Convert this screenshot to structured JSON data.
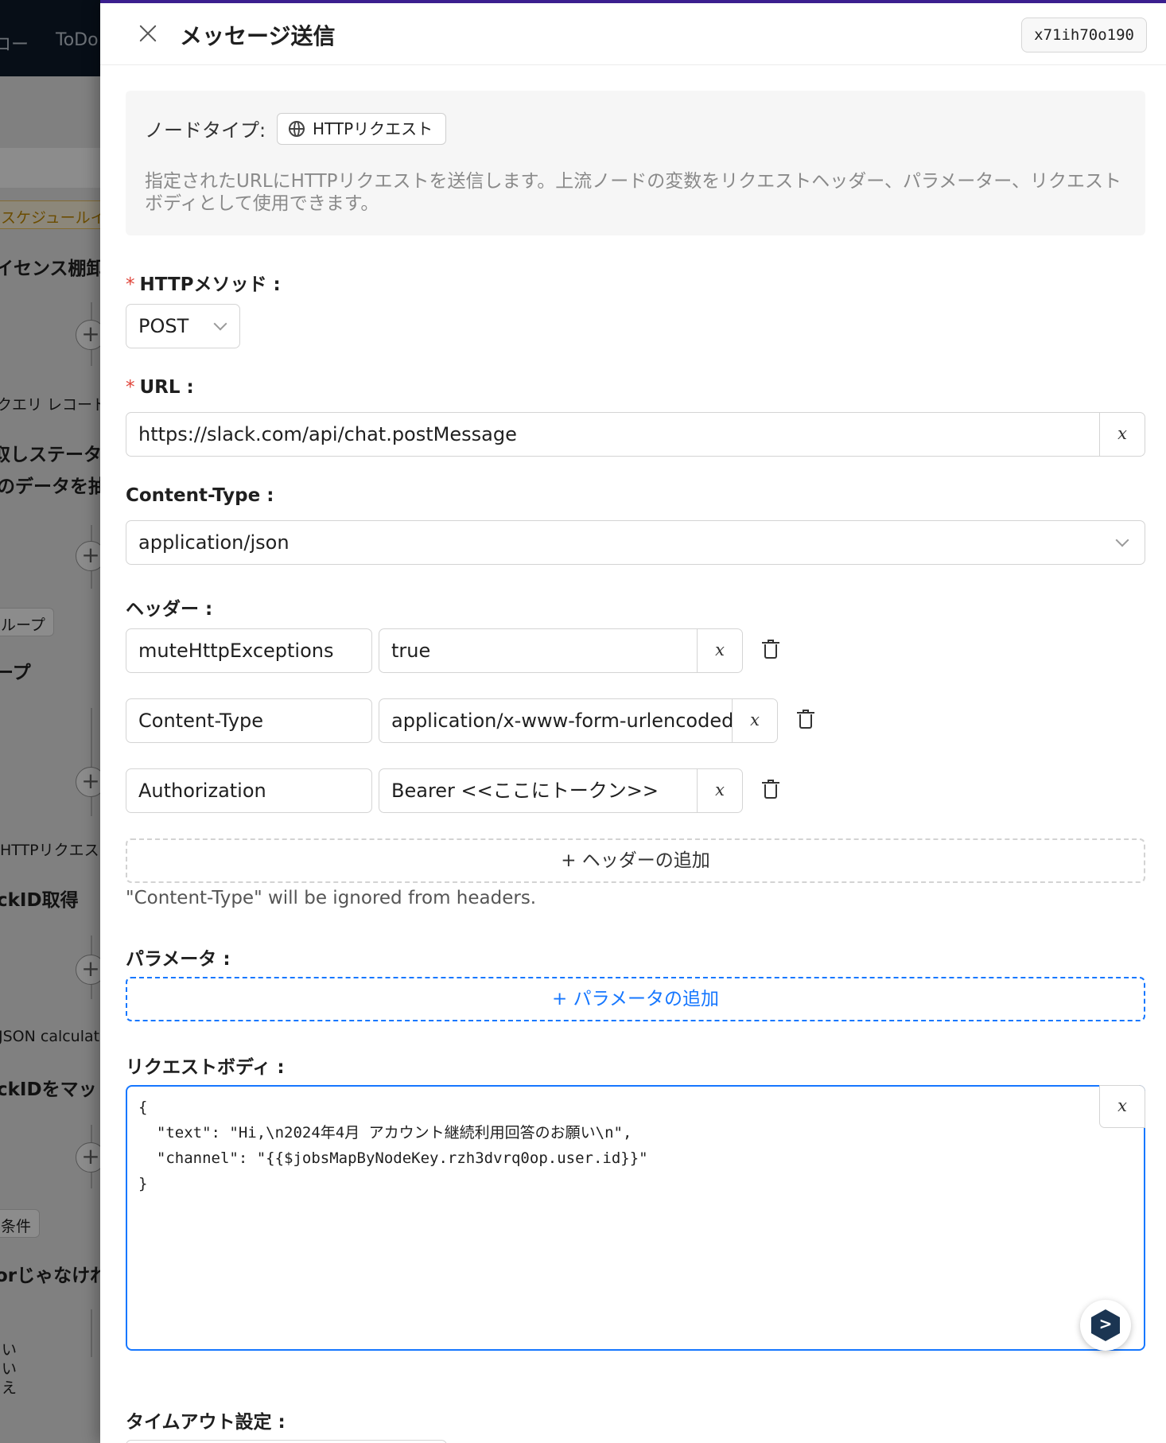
{
  "background": {
    "nav_items": [
      "ロー",
      "ToDo"
    ],
    "cards": [
      {
        "tag": "スケジュールイ",
        "title": "イセンス棚卸"
      },
      {
        "tag": "クエリ レコード",
        "title_line1": "取しステータ",
        "title_line2": "のデータを抽"
      },
      {
        "tag": "ループ",
        "title": "ープ"
      },
      {
        "tag": "HTTPリクエスト",
        "title": "ckID取得"
      },
      {
        "tag": "JSON calculat",
        "title": "ckIDをマッ"
      },
      {
        "tag": "条件",
        "title": "orじゃなけれ"
      }
    ],
    "bottom_lines": [
      "い",
      "い",
      "え"
    ]
  },
  "drawer": {
    "title": "メッセージ送信",
    "node_id": "x71ih70o190",
    "node_type_label": "ノードタイプ:",
    "node_type_value": "HTTPリクエスト",
    "node_type_icon": "globe-icon",
    "description": "指定されたURLにHTTPリクエストを送信します。上流ノードの変数をリクエストヘッダー、パラメーター、リクエストボディとして使用できます。",
    "method": {
      "label": "HTTPメソッド :",
      "value": "POST"
    },
    "url": {
      "label": "URL :",
      "value": "https://slack.com/api/chat.postMessage"
    },
    "content_type": {
      "label": "Content-Type :",
      "value": "application/json"
    },
    "headers": {
      "label": "ヘッダー :",
      "rows": [
        {
          "key": "muteHttpExceptions",
          "value": "true"
        },
        {
          "key": "Content-Type",
          "value": "application/x-www-form-urlencoded"
        },
        {
          "key": "Authorization",
          "value": "Bearer <<ここにトークン>>"
        }
      ],
      "add_label": "+ ヘッダーの追加",
      "note": "\"Content-Type\" will be ignored from headers."
    },
    "var_button_label": "x",
    "params": {
      "label": "パラメータ :",
      "add_label": "+ パラメータの追加"
    },
    "body": {
      "label": "リクエストボディ :",
      "value": "{\n  \"text\": \"Hi,\\n2024年4月 アカウント継続利用回答のお願い\\n\",\n  \"channel\": \"{{$jobsMapByNodeKey.rzh3dvrq0op.user.id}}\"\n}"
    },
    "timeout": {
      "label": "タイムアウト設定 :"
    },
    "colors": {
      "accent": "#1677ff",
      "required": "#e0453a",
      "top_border": "#3b1f8f",
      "nav_bg": "#0e1a2b"
    }
  }
}
